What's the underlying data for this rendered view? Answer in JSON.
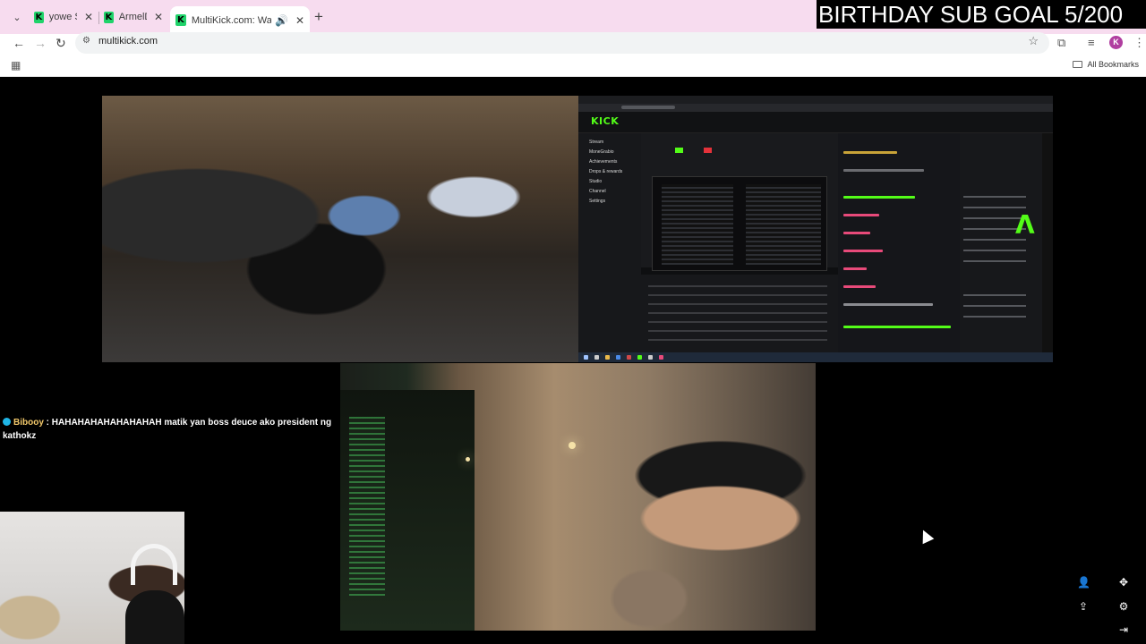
{
  "browser": {
    "tabs": [
      {
        "title": "yowe Stre",
        "active": false
      },
      {
        "title": "ArmelDo",
        "active": false
      },
      {
        "title": "MultiKick.com: Watch Mult",
        "active": true
      }
    ],
    "address": "multikick.com",
    "all_bookmarks_label": "All Bookmarks",
    "profile_initial": "K"
  },
  "overlay": {
    "goal_banner": "BIRTHDAY SUB GOAL 5/200"
  },
  "chat": {
    "username": "Biboоy",
    "separator": " : ",
    "message": "HAHAHAHAHAHAHAHAH matik yan boss deuce ako president ng kathokz"
  },
  "screen_share": {
    "logo": "KICK",
    "sidebar_items": [
      "Stream",
      "MoneGrabio",
      "Achievements",
      "Drops & rewards",
      "Studio",
      "Channel",
      "Settings"
    ]
  },
  "colors": {
    "tab_bar": "#f7dcef",
    "kick_green": "#53fc18",
    "chat_username": "#f3c96b"
  },
  "controls": {
    "add_user_icon": "add-user-icon",
    "move_icon": "move-icon",
    "share_icon": "share-icon",
    "settings_icon": "gear-icon",
    "exit_icon": "exit-icon"
  }
}
